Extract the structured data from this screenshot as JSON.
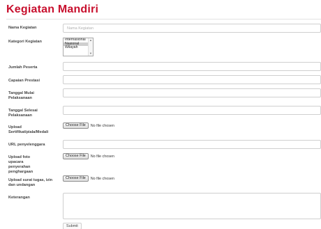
{
  "page": {
    "title": "Kegiatan Mandiri"
  },
  "form": {
    "nama_kegiatan": {
      "label": "Nama Kegiatan",
      "placeholder": "Nama Kegiatan",
      "value": ""
    },
    "kategori_kegiatan": {
      "label": "Kategori Kegiatan",
      "options": [
        "Internasional",
        "Nasional",
        "Wilayah"
      ],
      "selected": "Nasional"
    },
    "jumlah_peserta": {
      "label": "Jumlah Peserta",
      "value": ""
    },
    "capaian_prestasi": {
      "label": "Capaian Prestasi",
      "value": ""
    },
    "tanggal_mulai": {
      "label": "Tanggal Mulai Pelaksanaan",
      "value": ""
    },
    "tanggal_selesai": {
      "label": "Tanggal Selesai Pelaksanaan",
      "value": ""
    },
    "upload_sertifikat": {
      "label": "Upload Sertifikat/piala/Medali",
      "button": "Choose File",
      "status": "No file chosen"
    },
    "url_penyelenggara": {
      "label": "URL penyelenggara",
      "value": ""
    },
    "upload_foto": {
      "label": "Upload foto upacara penyerahan penghargaan",
      "button": "Choose File",
      "status": "No file chosen"
    },
    "upload_surat": {
      "label": "Upload surat tugas, izin dan undangan",
      "button": "Choose File",
      "status": "No file chosen"
    },
    "keterangan": {
      "label": "Keterangan",
      "value": ""
    },
    "submit_label": "Submit"
  }
}
